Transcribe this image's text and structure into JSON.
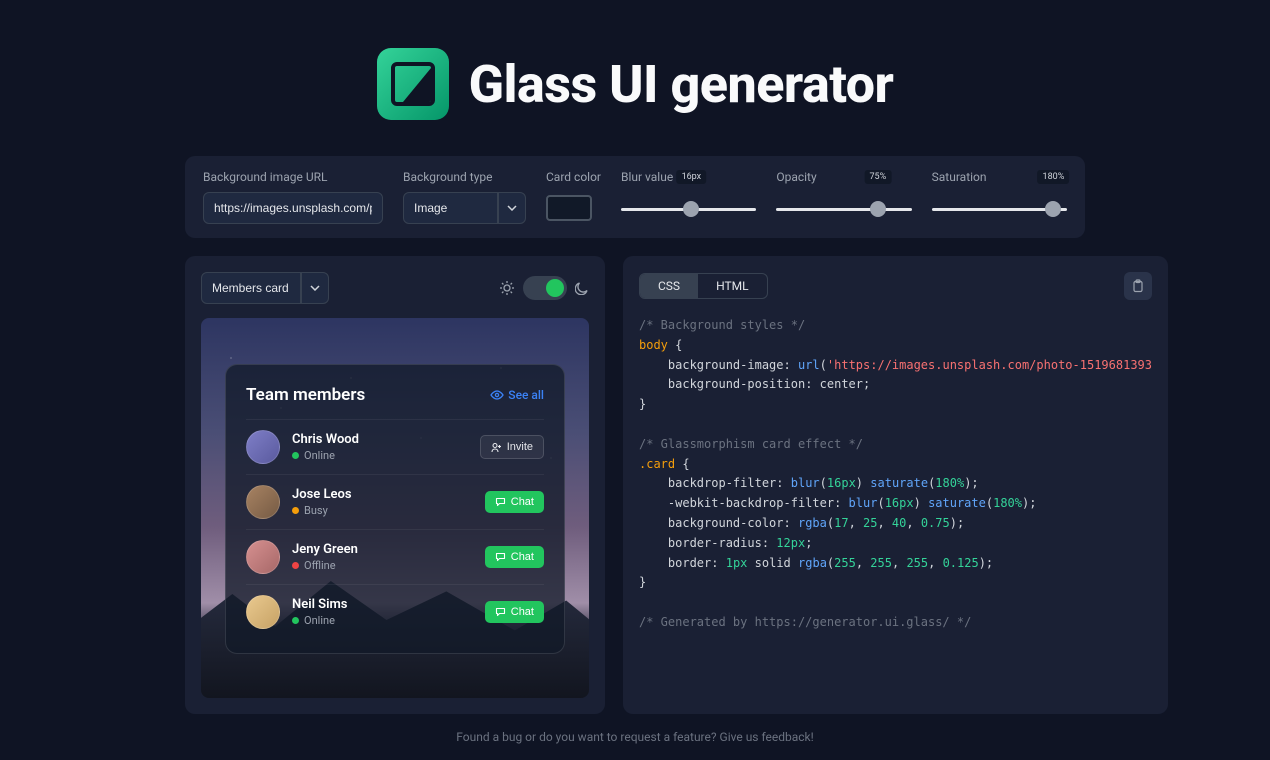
{
  "header": {
    "title": "Glass UI generator"
  },
  "controls": {
    "bg_url_label": "Background image URL",
    "bg_url_value": "https://images.unsplash.com/photo-151",
    "bg_type_label": "Background type",
    "bg_type_value": "Image",
    "card_color_label": "Card color",
    "blur_label": "Blur value",
    "blur_badge": "16px",
    "blur_pct": 52,
    "opacity_label": "Opacity",
    "opacity_badge": "75%",
    "opacity_pct": 75,
    "saturation_label": "Saturation",
    "saturation_badge": "180%",
    "saturation_pct": 90
  },
  "preview": {
    "dropdown_value": "Members card",
    "card_title": "Team members",
    "see_all": "See all",
    "invite": "Invite",
    "chat": "Chat",
    "members": [
      {
        "name": "Chris Wood",
        "status": "Online",
        "dot": "online",
        "action": "invite"
      },
      {
        "name": "Jose Leos",
        "status": "Busy",
        "dot": "busy",
        "action": "chat"
      },
      {
        "name": "Jeny Green",
        "status": "Offline",
        "dot": "offline",
        "action": "chat"
      },
      {
        "name": "Neil Sims",
        "status": "Online",
        "dot": "online",
        "action": "chat"
      }
    ]
  },
  "code": {
    "tab_css": "CSS",
    "tab_html": "HTML",
    "c1": "/* Background styles */",
    "c2": "body",
    "c3": "background-image",
    "c4": "url",
    "c5": "'https://images.unsplash.com/photo-1519681393",
    "c6": "background-position",
    "c7": "center",
    "c8": "/* Glassmorphism card effect */",
    "c9": ".card",
    "c10": "backdrop-filter",
    "c11": "blur",
    "c12": "16px",
    "c13": "saturate",
    "c14": "180%",
    "c15": "-webkit-backdrop-filter",
    "c16": "background-color",
    "c17": "rgba",
    "c18_1": "17",
    "c18_2": "25",
    "c18_3": "40",
    "c18_4": "0.75",
    "c19": "border-radius",
    "c20": "12px",
    "c21": "border",
    "c22": "1px",
    "c23": "solid",
    "c24_1": "255",
    "c24_2": "255",
    "c24_3": "255",
    "c24_4": "0.125",
    "c25": "/* Generated by https://generator.ui.glass/ */"
  },
  "footer": {
    "text": "Found a bug or do you want to request a feature? Give us feedback!"
  }
}
